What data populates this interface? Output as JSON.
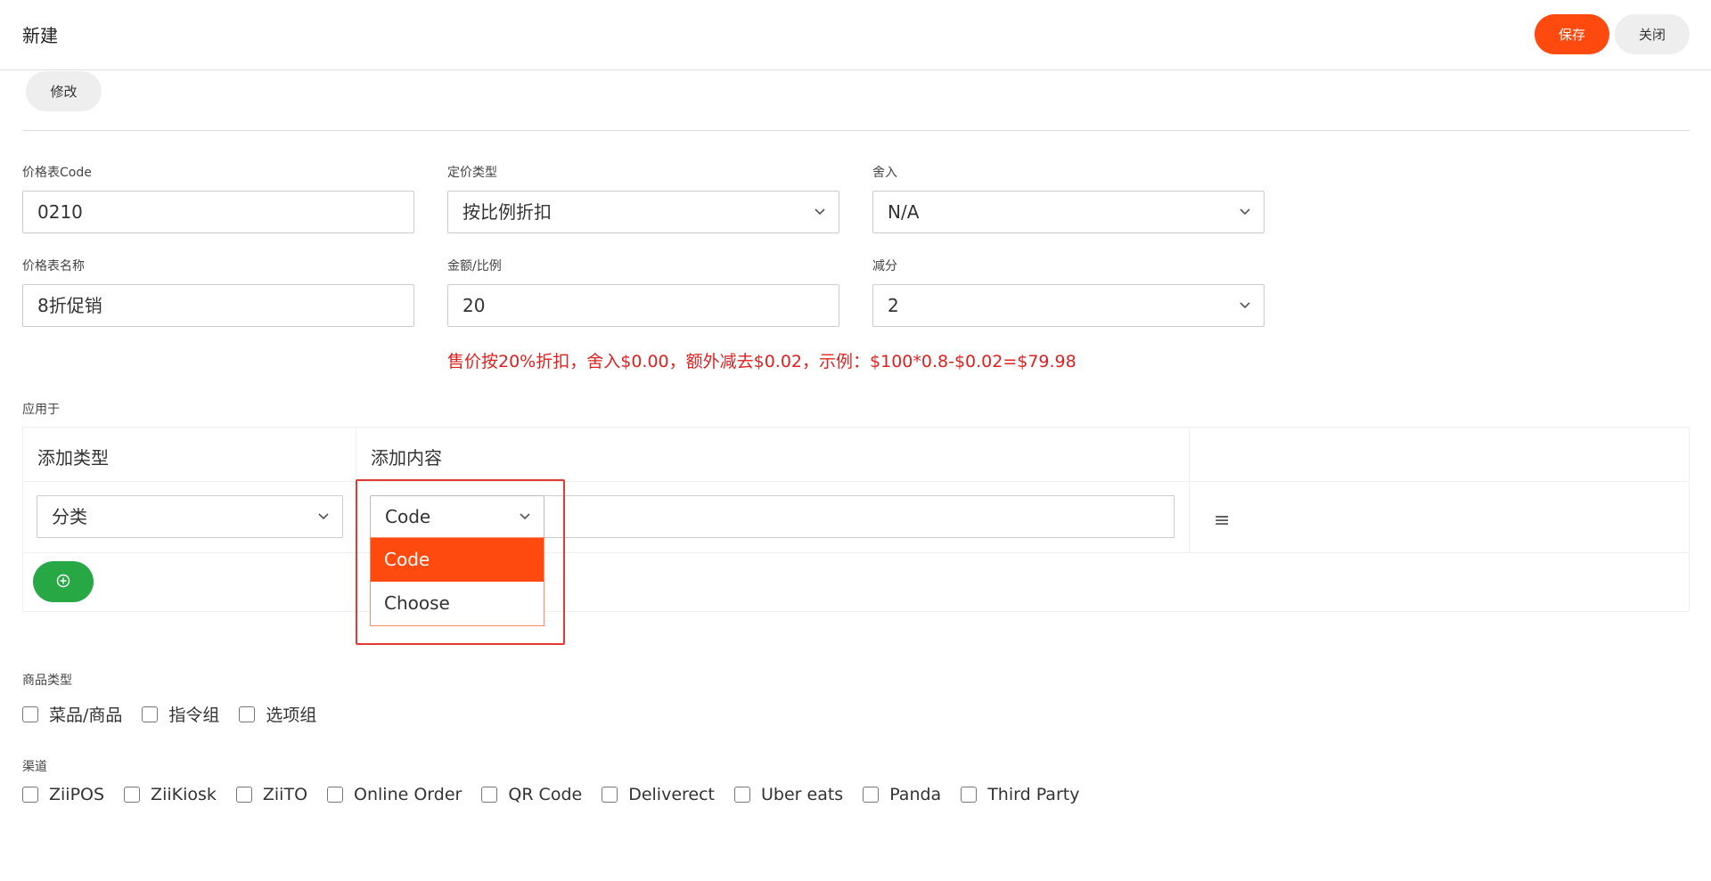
{
  "header": {
    "title": "新建",
    "save_label": "保存",
    "close_label": "关闭"
  },
  "toolbar": {
    "edit_label": "修改"
  },
  "form": {
    "code_label": "价格表Code",
    "code_value": "0210",
    "pricing_type_label": "定价类型",
    "pricing_type_value": "按比例折扣",
    "rounding_label": "舍入",
    "rounding_value": "N/A",
    "name_label": "价格表名称",
    "name_value": "8折促销",
    "amount_label": "金额/比例",
    "amount_value": "20",
    "deduct_label": "减分",
    "deduct_value": "2",
    "hint": "售价按20%折扣，舍入$0.00，额外减去$0.02，示例：$100*0.8-$0.02=$79.98"
  },
  "apply": {
    "label": "应用于",
    "col_type": "添加类型",
    "col_content": "添加内容",
    "row_type_value": "分类",
    "row_code_value": "Code",
    "dropdown_options": [
      "Code",
      "Choose"
    ],
    "menu_icon": "≡",
    "add_icon": "plus-circle-icon"
  },
  "product_types": {
    "label": "商品类型",
    "items": [
      "菜品/商品",
      "指令组",
      "选项组"
    ]
  },
  "channels": {
    "label": "渠道",
    "items": [
      "ZiiPOS",
      "ZiiKiosk",
      "ZiiTO",
      "Online Order",
      "QR Code",
      "Deliverect",
      "Uber eats",
      "Panda",
      "Third Party"
    ]
  },
  "colors": {
    "accent": "#ff4a0f",
    "success": "#28a745",
    "error": "#e02020"
  }
}
